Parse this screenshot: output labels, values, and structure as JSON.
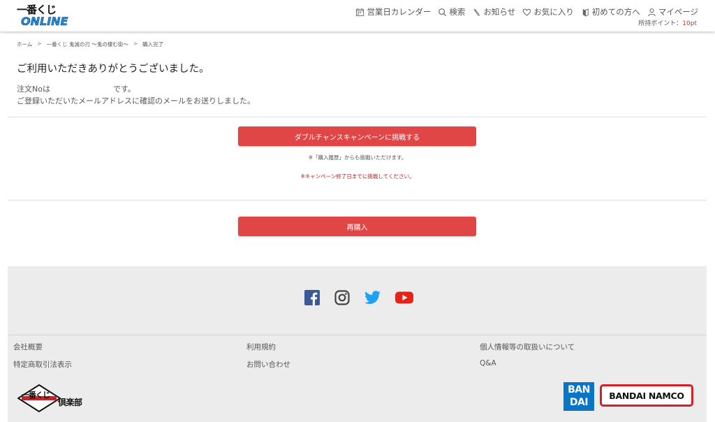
{
  "header": {
    "logo_top": "一番くじ",
    "logo_bottom": "ONLINE",
    "nav": [
      {
        "label": "営業日カレンダー",
        "icon": "calendar-icon"
      },
      {
        "label": "検索",
        "icon": "search-icon"
      },
      {
        "label": "お知らせ",
        "icon": "bell-icon"
      },
      {
        "label": "お気に入り",
        "icon": "heart-icon"
      },
      {
        "label": "初めての方へ",
        "icon": "leaf-icon"
      },
      {
        "label": "マイページ",
        "icon": "user-icon"
      }
    ],
    "points_label": "所持ポイント：",
    "points_value": "10pt"
  },
  "breadcrumb": [
    {
      "label": "ホーム"
    },
    {
      "label": "一番くじ 鬼滅の刃 〜鬼の棲む街〜"
    },
    {
      "label": "購入完了"
    }
  ],
  "breadcrumb_sep": ">",
  "main": {
    "thanks": "ご利用いただきありがとうございました。",
    "order_prefix": "注文Noは",
    "order_suffix": "です。",
    "mail_notice": "ご登録いただいたメールアドレスに確認のメールをお送りしました。",
    "campaign_button": "ダブルチャンスキャンペーンに挑戦する",
    "history_note": "※「購入履歴」からも挑戦いただけます。",
    "deadline_note": "※キャンペーン終了日までに挑戦してください。",
    "repurchase_button": "再購入"
  },
  "footer": {
    "social": [
      {
        "name": "facebook-icon",
        "color": "#3b5998"
      },
      {
        "name": "instagram-icon",
        "color": "#444444"
      },
      {
        "name": "twitter-icon",
        "color": "#1da1f2"
      },
      {
        "name": "youtube-icon",
        "color": "#e62117"
      }
    ],
    "links": {
      "company": "会社概要",
      "terms": "利用規約",
      "privacy": "個人情報等の取扱いについて",
      "tokusho": "特定商取引法表示",
      "contact": "お問い合わせ",
      "qa": "Q&A"
    },
    "club_logo_top": "一番くじ",
    "club_logo_text": "倶楽部",
    "bandai_line1": "BAN",
    "bandai_line2": "DAI",
    "namco": "BANDAI NAMCO"
  },
  "colors": {
    "accent_button": "#e04646",
    "footer_bg": "#ececec",
    "points": "#c0392b"
  }
}
